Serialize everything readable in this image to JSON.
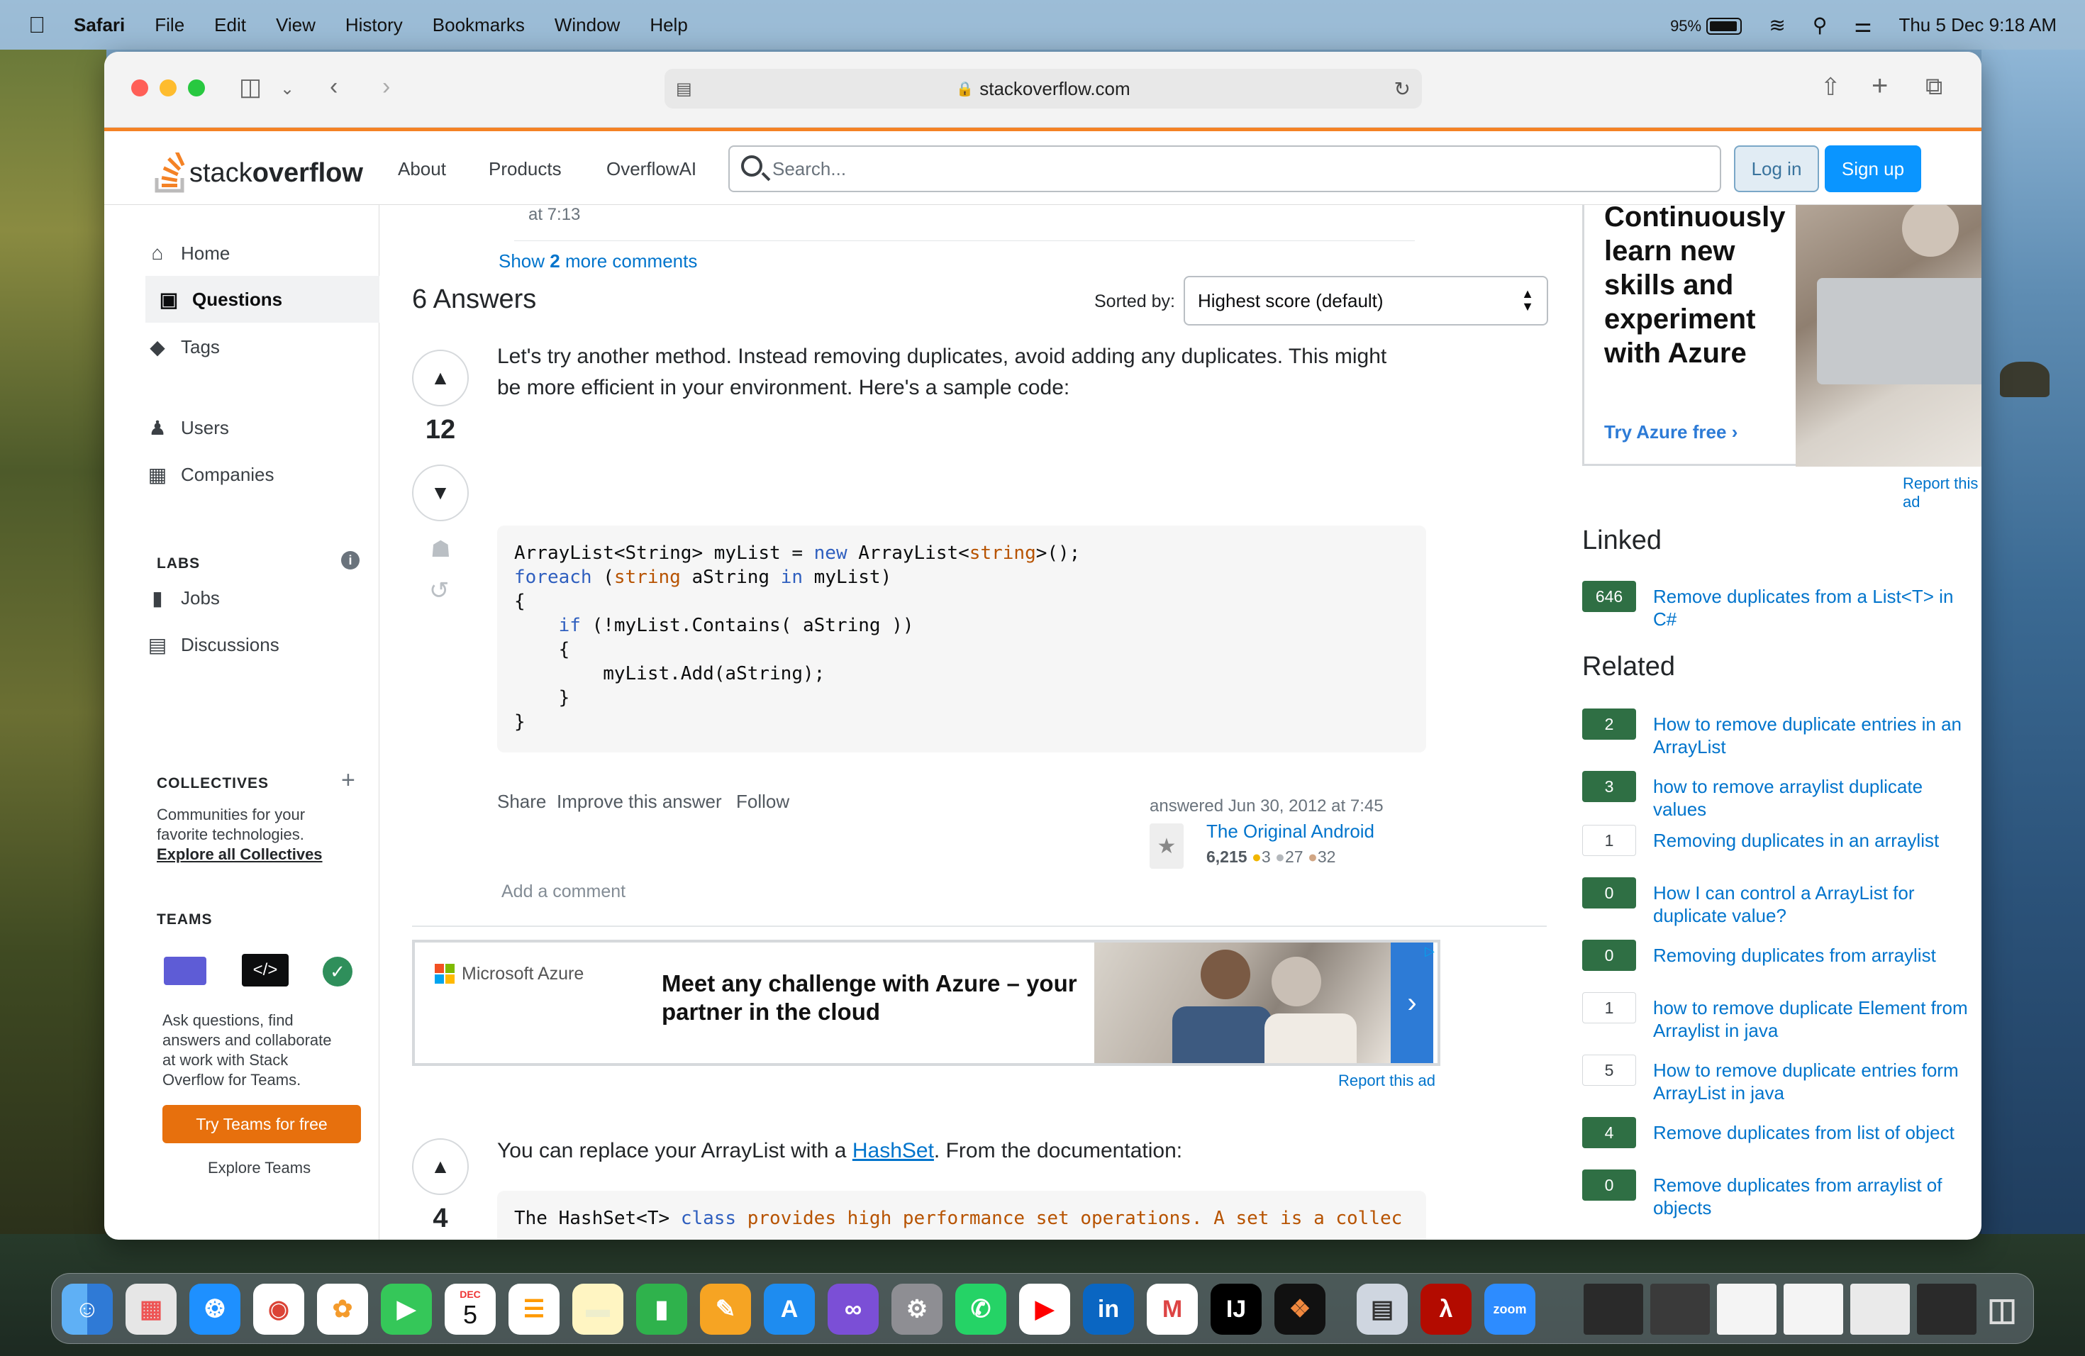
{
  "menubar": {
    "app": "Safari",
    "items": [
      "File",
      "Edit",
      "View",
      "History",
      "Bookmarks",
      "Window",
      "Help"
    ],
    "battery": "95%",
    "datetime": "Thu 5 Dec  9:18 AM"
  },
  "browser": {
    "url": "stackoverflow.com"
  },
  "so_header": {
    "logo_a": "stack",
    "logo_b": "overflow",
    "nav": [
      "About",
      "Products",
      "OverflowAI"
    ],
    "search_placeholder": "Search...",
    "login": "Log in",
    "signup": "Sign up"
  },
  "sidebar": {
    "home": "Home",
    "questions": "Questions",
    "tags": "Tags",
    "users": "Users",
    "companies": "Companies",
    "labs": "LABS",
    "jobs": "Jobs",
    "discussions": "Discussions",
    "collectives": "COLLECTIVES",
    "collectives_desc_1": "Communities for your",
    "collectives_desc_2": "favorite technologies.",
    "collectives_link": "Explore all Collectives",
    "teams": "TEAMS",
    "teams_desc_1": "Ask questions, find",
    "teams_desc_2": "answers and collaborate",
    "teams_desc_3": "at work with Stack",
    "teams_desc_4": "Overflow for Teams.",
    "teams_btn": "Try Teams for free",
    "teams_explore": "Explore Teams"
  },
  "main": {
    "prev_comment_time": "at 7:13",
    "show_more_a": "Show ",
    "show_more_n": "2",
    "show_more_b": " more comments",
    "answers_count": "6 Answers",
    "sorted_by": "Sorted by:",
    "sort_value": "Highest score (default)",
    "answer1": {
      "score": "12",
      "text_1": "Let's try another method. Instead removing duplicates, avoid adding any duplicates. This might",
      "text_2": "be more efficient in your environment. Here's a sample code:",
      "actions": [
        "Share",
        "Improve this answer",
        "Follow"
      ],
      "answered": "answered Jun 30, 2012 at 7:45",
      "user": "The Original Android",
      "rep": "6,215",
      "gold": "3",
      "silver": "27",
      "bronze": "32",
      "add_comment": "Add a comment"
    },
    "ad": {
      "brand": "Microsoft Azure",
      "headline_1": "Meet any challenge with Azure – your",
      "headline_2": "partner in the cloud",
      "report": "Report this ad"
    },
    "answer2": {
      "score": "4",
      "text_pre": "You can replace your ArrayList with a ",
      "text_link": "HashSet",
      "text_post": ". From the documentation:"
    }
  },
  "right": {
    "ad_lines": [
      "Continuously",
      "learn new",
      "skills and",
      "experiment",
      "with Azure"
    ],
    "ad_cta": "Try Azure free",
    "ad_report": "Report this ad",
    "linked_title": "Linked",
    "linked": [
      {
        "score": "646",
        "title": "Remove duplicates from a List<T> in C#",
        "accepted": true
      }
    ],
    "related_title": "Related",
    "related": [
      {
        "score": "2",
        "t1": "How to remove duplicate entries in an",
        "t2": "ArrayList",
        "accepted": true
      },
      {
        "score": "3",
        "t1": "how to remove arraylist duplicate values",
        "t2": "",
        "accepted": true
      },
      {
        "score": "1",
        "t1": "Removing duplicates in an arraylist",
        "t2": "",
        "accepted": false
      },
      {
        "score": "0",
        "t1": "How I can control a ArrayList for",
        "t2": "duplicate value?",
        "accepted": true
      },
      {
        "score": "0",
        "t1": "Removing duplicates from arraylist",
        "t2": "",
        "accepted": true
      },
      {
        "score": "1",
        "t1": "how to remove duplicate Element from",
        "t2": "Arraylist in java",
        "accepted": false
      },
      {
        "score": "5",
        "t1": "How to remove duplicate entries form",
        "t2": "ArrayList in java",
        "accepted": false
      },
      {
        "score": "4",
        "t1": "Remove duplicates from list of object",
        "t2": "",
        "accepted": true
      },
      {
        "score": "0",
        "t1": "Remove duplicates from arraylist of",
        "t2": "objects",
        "accepted": true
      }
    ]
  },
  "dock": {
    "calendar_month": "DEC",
    "calendar_day": "5",
    "zoom_label": "zoom"
  }
}
